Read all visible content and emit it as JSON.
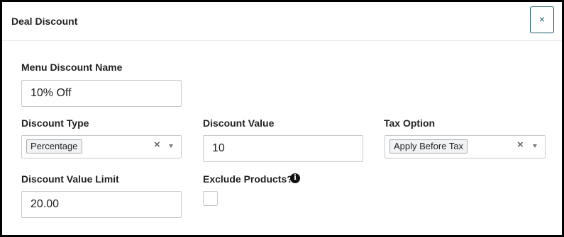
{
  "modal": {
    "title": "Deal Discount",
    "close_label": "×"
  },
  "form": {
    "menu_discount_name": {
      "label": "Menu Discount Name",
      "value": "10% Off"
    },
    "discount_type": {
      "label": "Discount Type",
      "selected": "Percentage",
      "clear": "×"
    },
    "discount_value": {
      "label": "Discount Value",
      "value": "10"
    },
    "tax_option": {
      "label": "Tax Option",
      "selected": "Apply Before Tax",
      "clear": "×"
    },
    "discount_value_limit": {
      "label": "Discount Value Limit",
      "value": "20.00"
    },
    "exclude_products": {
      "label": "Exclude Products?",
      "checked": false,
      "info_icon": "info-icon"
    }
  },
  "colors": {
    "border": "#000000",
    "accent": "#1b5e70",
    "input_border": "#c6c9cc"
  }
}
